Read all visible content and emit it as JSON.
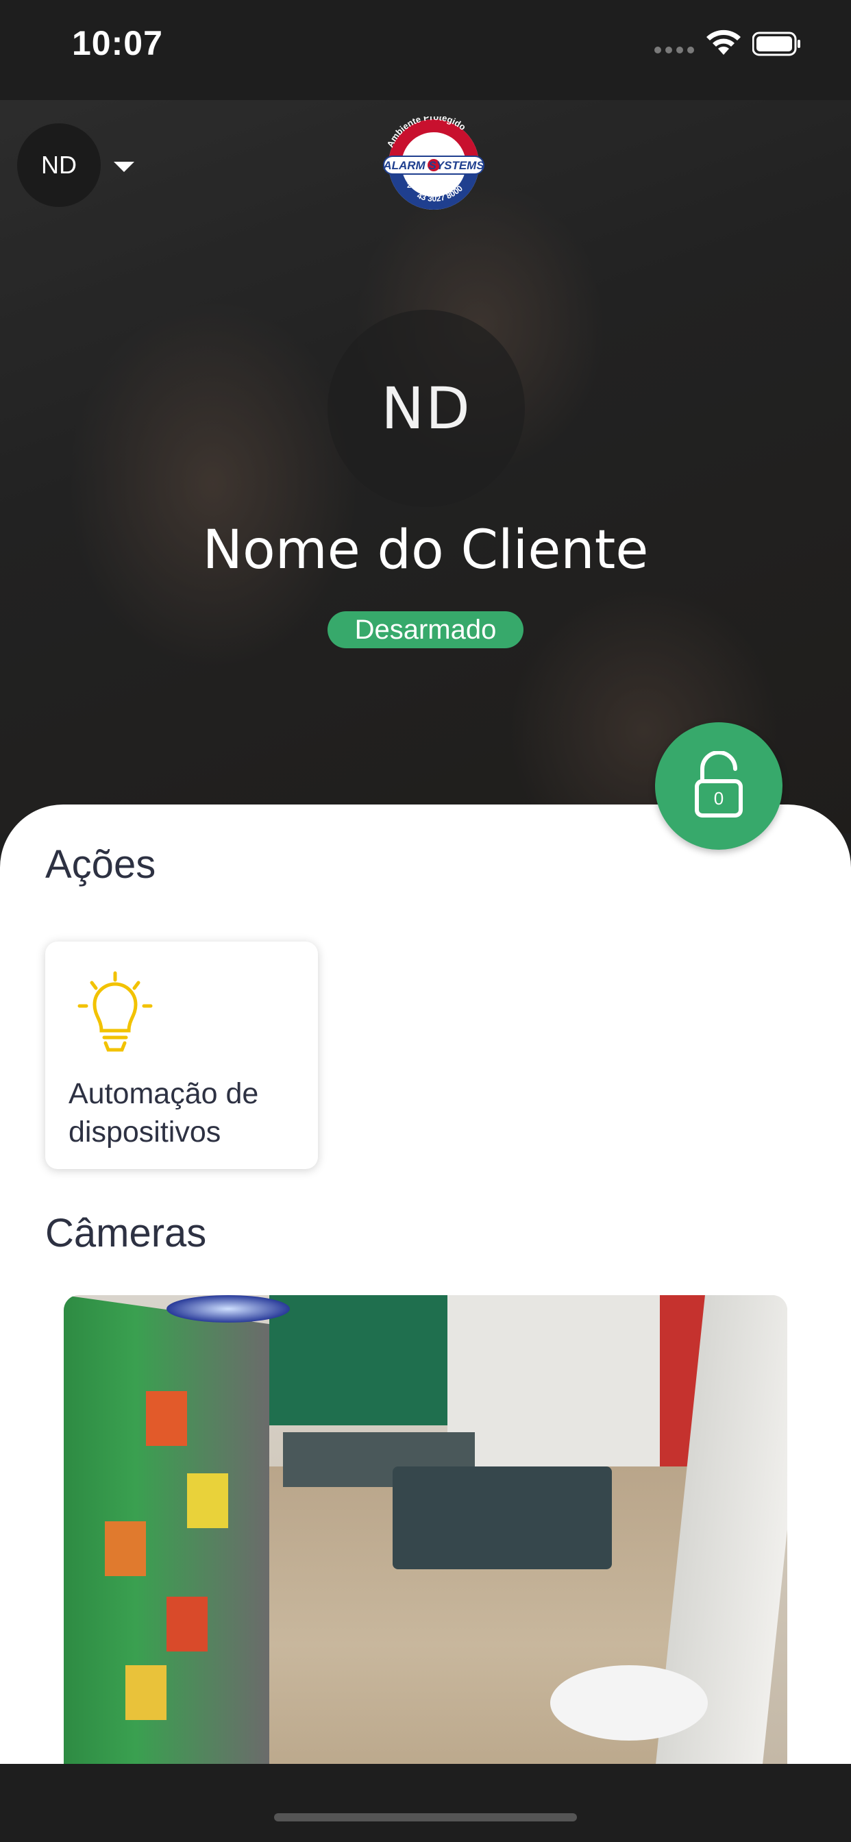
{
  "status_bar": {
    "time": "10:07"
  },
  "header": {
    "account_initials": "ND",
    "logo": {
      "top_text": "Ambiente Protegido",
      "brand": "ALARM SYSTEMS",
      "badge": "24h",
      "phone": "43 3027 8000"
    }
  },
  "profile": {
    "initials": "ND",
    "name": "Nome do Cliente",
    "status": "Desarmado",
    "lock_count": "0"
  },
  "actions": {
    "title": "Ações",
    "items": [
      {
        "label": "Automação de dispositivos",
        "icon": "lightbulb-icon"
      }
    ]
  },
  "cameras": {
    "title": "Câmeras"
  },
  "colors": {
    "accent_green": "#37a96b",
    "bulb_yellow": "#f2c200",
    "text_dark": "#2d3142"
  }
}
